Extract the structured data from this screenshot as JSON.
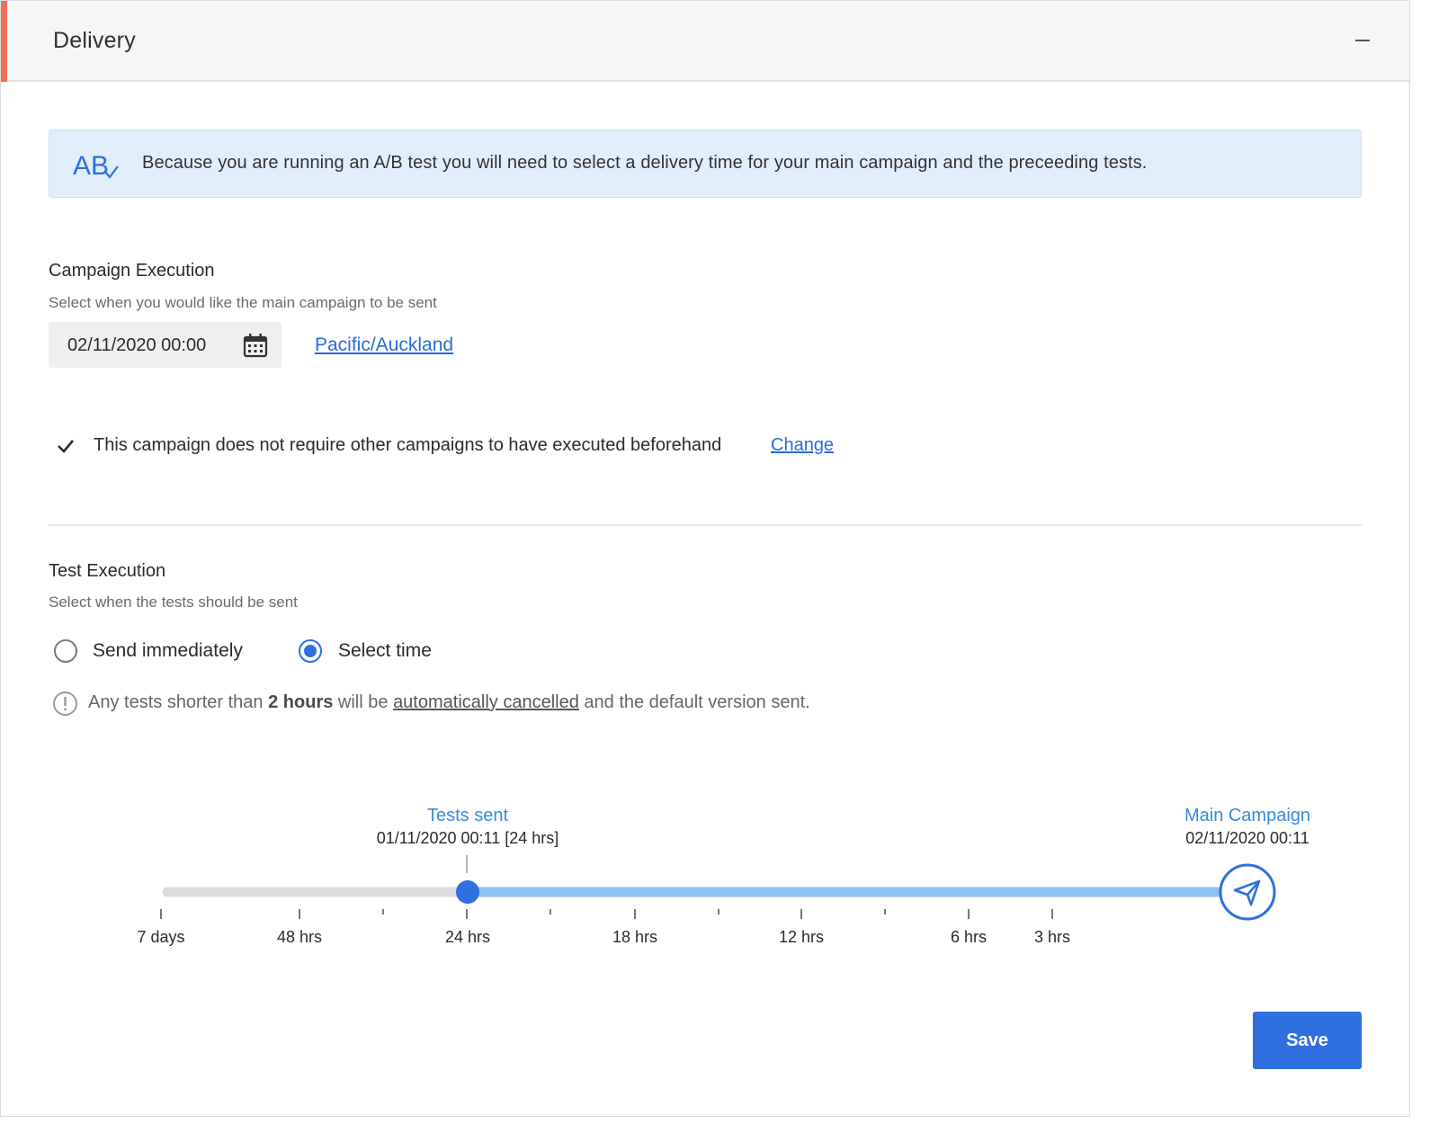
{
  "header": {
    "title": "Delivery",
    "collapse_icon": "minus-icon",
    "accent_color": "#f0715a"
  },
  "banner": {
    "icon": "ab-test-icon",
    "icon_text": "AB",
    "text": "Because you are running an A/B test you will need to select a delivery time for your main campaign and the preceeding tests."
  },
  "campaign_execution": {
    "title": "Campaign Execution",
    "subtitle": "Select when you would like the main campaign to be sent",
    "date_value": "02/11/2020 00:00",
    "timezone_link": "Pacific/Auckland",
    "dependency_text": "This campaign does not require other campaigns to have executed beforehand",
    "change_link": "Change"
  },
  "test_execution": {
    "title": "Test Execution",
    "subtitle": "Select when the tests should be sent",
    "options": [
      {
        "label": "Send immediately",
        "selected": false
      },
      {
        "label": "Select time",
        "selected": true
      }
    ],
    "warning": {
      "prefix": "Any tests shorter than ",
      "bold": "2 hours",
      "middle": " will be ",
      "link": "automatically cancelled",
      "suffix": " and the default version sent."
    }
  },
  "timeline": {
    "tests_sent_title": "Tests sent",
    "tests_sent_value": "01/11/2020 00:11 [24 hrs]",
    "main_campaign_title": "Main Campaign",
    "main_campaign_value": "02/11/2020 00:11",
    "ticks": [
      "7 days",
      "48 hrs",
      "24 hrs",
      "18 hrs",
      "12 hrs",
      "6 hrs",
      "3 hrs"
    ],
    "selected_tick": "24 hrs",
    "track_color": "#8fc2f3",
    "handle_color": "#2f6fe0",
    "end_icon": "paper-plane-icon"
  },
  "footer": {
    "save_label": "Save",
    "save_color": "#2f6fe0"
  }
}
